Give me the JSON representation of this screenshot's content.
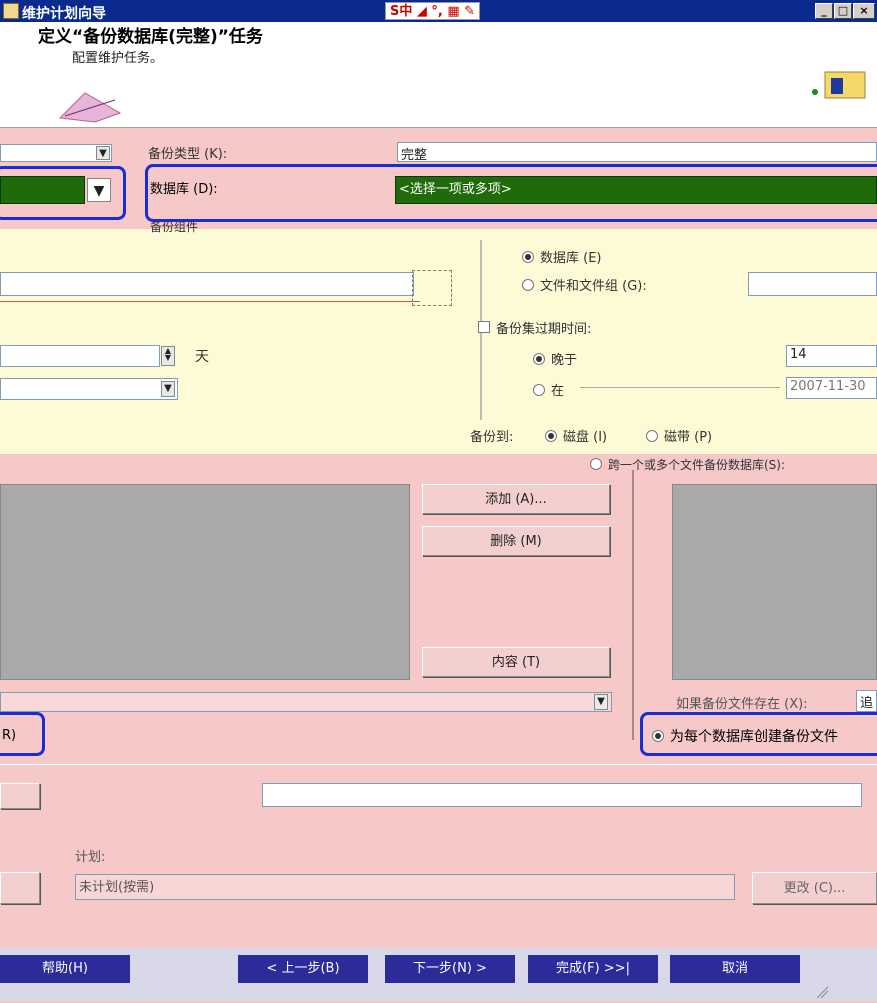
{
  "window": {
    "title": "维护计划向导",
    "ime": "S中 ◢ °, ▦ ✎",
    "min": "_",
    "max": "□",
    "close": "×"
  },
  "header": {
    "title": "定义“备份数据库(完整)”任务",
    "subtitle": "配置维护任务。"
  },
  "form": {
    "backup_type_label": "备份类型 (K):",
    "backup_type_value": "完整",
    "database_label": "数据库 (D):",
    "database_value": "<选择一项或多项>",
    "backup_component_label": "备份组件",
    "radio_database": "数据库 (E)",
    "radio_files": "文件和文件组 (G):",
    "expire_label": "备份集过期时间:",
    "later_than": "晚于",
    "later_value": "14",
    "days_unit": "天",
    "on_label": "在",
    "on_value": "2007-11-30",
    "backup_to_label": "备份到:",
    "disk_label": "磁盘 (I)",
    "tape_label": "磁带 (P)",
    "span_label": "跨一个或多个文件备份数据库(S):",
    "add_button": "添加 (A)...",
    "remove_button": "删除 (M)",
    "contents_button": "内容 (T)",
    "if_exists_label": "如果备份文件存在 (X):",
    "if_exists_value": "追",
    "create_per_db": "为每个数据库创建备份文件",
    "left_radio_fragment": "R)",
    "schedule_label": "计划:",
    "schedule_value": "未计划(按需)",
    "change_button": "更改 (C)..."
  },
  "nav": {
    "help": "帮助(H)",
    "back": "< 上一步(B)",
    "next": "下一步(N) >",
    "finish": "完成(F) >>|",
    "cancel": "取消"
  },
  "colors": {
    "title_bar": "#0a2a8f",
    "highlight_frame": "#1a2cd6",
    "selected_green": "#1f6a0a"
  }
}
